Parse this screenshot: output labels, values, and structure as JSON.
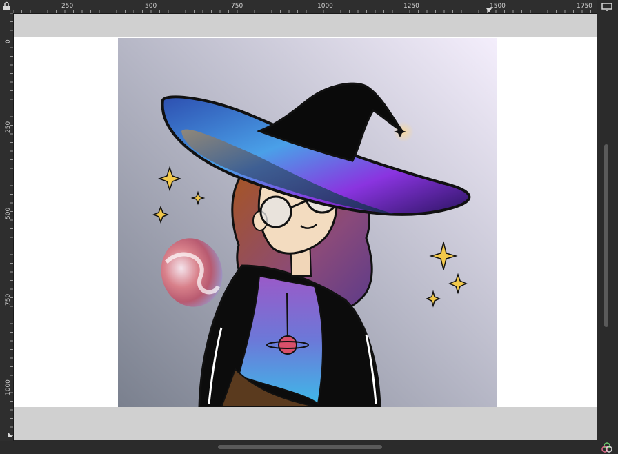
{
  "ruler": {
    "horizontal_ticks": [
      "250",
      "500",
      "750",
      "1000",
      "1250",
      "1500",
      "1750"
    ],
    "vertical_ticks": [
      "0",
      "250",
      "500",
      "750",
      "1000"
    ]
  },
  "icons": {
    "lock": "lock-icon",
    "display": "monitor-icon",
    "color_channels": "color-channels-icon",
    "nav": "navigate-icon"
  },
  "colors": {
    "canvas_bg": "#d0d0d0",
    "ui_bg": "#2b2b2b",
    "sky_top": "#f2ecfa",
    "sky_bottom": "#7c8290",
    "hat_purple": "#8a34e0",
    "hat_blue": "#3a7fd8"
  }
}
